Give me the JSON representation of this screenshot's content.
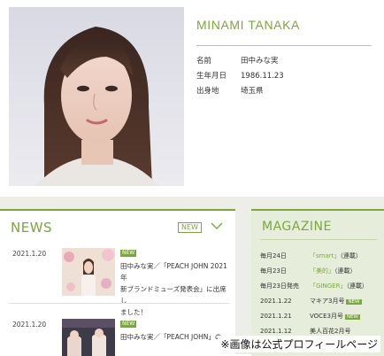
{
  "profile": {
    "name": "MINAMI TANAKA",
    "rows": [
      {
        "label": "名前",
        "value": "田中みな実"
      },
      {
        "label": "生年月日",
        "value": "1986.11.23"
      },
      {
        "label": "出身地",
        "value": "埼玉県"
      }
    ]
  },
  "news": {
    "title": "NEWS",
    "badge": "NEW",
    "items": [
      {
        "date": "2021.1.20",
        "badge": "NEW",
        "lines": [
          "田中みな実／「PEACH JOHN 2021年",
          "新ブランドミューズ発表会」に出席し",
          "ました！"
        ]
      },
      {
        "date": "2021.1.20",
        "badge": "NEW",
        "lines": [
          "田中みな実／「PEACH JOHN」の"
        ]
      }
    ]
  },
  "magazine": {
    "title": "MAGAZINE",
    "items": [
      {
        "date": "毎月24日",
        "link": "「smart」",
        "note": "（連載）",
        "new": ""
      },
      {
        "date": "毎月23日",
        "link": "「美的」",
        "note": "（連載）",
        "new": ""
      },
      {
        "date": "毎月23日発売",
        "link": "「GINGER」",
        "note": "（連載）",
        "new": ""
      },
      {
        "date": "2021.1.22",
        "link": "",
        "note": "マキア3月号",
        "new": "NEW"
      },
      {
        "date": "2021.1.21",
        "link": "",
        "note": "VOCE3月号",
        "new": "NEW"
      },
      {
        "date": "2021.1.12",
        "link": "",
        "note": "美人百花2月号",
        "new": ""
      }
    ]
  },
  "caption": "※画像は公式プロフィールページ"
}
